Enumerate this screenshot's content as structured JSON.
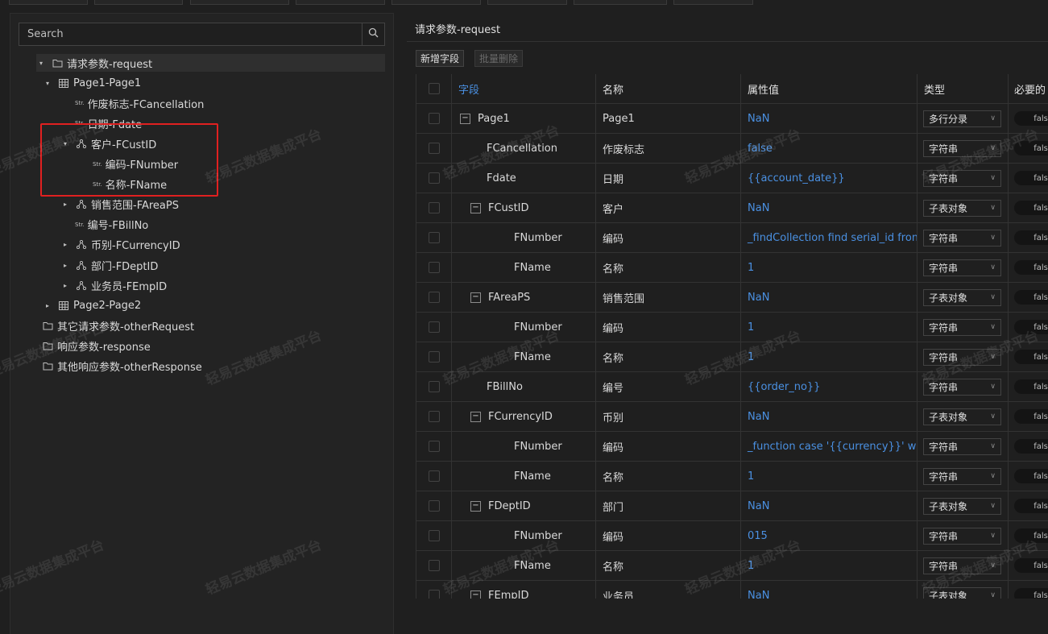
{
  "watermark": "轻易云数据集成平台",
  "search": {
    "placeholder": "Search"
  },
  "tree": [
    {
      "label": "请求参数-request",
      "icon": "folder-icon",
      "caret": "▾",
      "level": 0,
      "selected": true
    },
    {
      "label": "Page1-Page1",
      "icon": "table-icon",
      "caret": "▾",
      "level": 1
    },
    {
      "label": "作废标志-FCancellation",
      "icon": "string-icon",
      "caret": "",
      "level": 2
    },
    {
      "label": "日期-Fdate",
      "icon": "string-icon",
      "caret": "",
      "level": 2
    },
    {
      "label": "客户-FCustID",
      "icon": "object-icon",
      "caret": "▾",
      "level": 2
    },
    {
      "label": "编码-FNumber",
      "icon": "string-icon",
      "caret": "",
      "level": 3
    },
    {
      "label": "名称-FName",
      "icon": "string-icon",
      "caret": "",
      "level": 3
    },
    {
      "label": "销售范围-FAreaPS",
      "icon": "object-icon",
      "caret": "▸",
      "level": 2
    },
    {
      "label": "编号-FBillNo",
      "icon": "string-icon",
      "caret": "",
      "level": 2
    },
    {
      "label": "币别-FCurrencyID",
      "icon": "object-icon",
      "caret": "▸",
      "level": 2
    },
    {
      "label": "部门-FDeptID",
      "icon": "object-icon",
      "caret": "▸",
      "level": 2
    },
    {
      "label": "业务员-FEmpID",
      "icon": "object-icon",
      "caret": "▸",
      "level": 2
    },
    {
      "label": "Page2-Page2",
      "icon": "table-icon",
      "caret": "▸",
      "level": 1
    },
    {
      "label": "其它请求参数-otherRequest",
      "icon": "folder-icon",
      "caret": "",
      "level": 0
    },
    {
      "label": "响应参数-response",
      "icon": "folder-icon",
      "caret": "",
      "level": 0
    },
    {
      "label": "其他响应参数-otherResponse",
      "icon": "folder-icon",
      "caret": "",
      "level": 0
    }
  ],
  "tree_string_badge": "Str.",
  "panel": {
    "title": "请求参数-request",
    "add_button": "新增字段",
    "bulk_delete_button": "批量删除"
  },
  "table": {
    "headers": {
      "field": "字段",
      "name": "名称",
      "value": "属性值",
      "type": "类型",
      "required": "必要的"
    },
    "rows": [
      {
        "field": "Page1",
        "name": "Page1",
        "value": "NaN",
        "type": "多行分录",
        "required": "false",
        "indent": 0,
        "expand": true
      },
      {
        "field": "FCancellation",
        "name": "作废标志",
        "value": "false",
        "type": "字符串",
        "required": "false",
        "indent": 1,
        "expand": false
      },
      {
        "field": "Fdate",
        "name": "日期",
        "value": "{{account_date}}",
        "type": "字符串",
        "required": "false",
        "indent": 1,
        "expand": false
      },
      {
        "field": "FCustID",
        "name": "客户",
        "value": "NaN",
        "type": "子表对象",
        "required": "false",
        "indent": 1,
        "expand": true
      },
      {
        "field": "FNumber",
        "name": "编码",
        "value": "_findCollection find serial_id from ...",
        "type": "字符串",
        "required": "false",
        "indent": 2,
        "expand": false
      },
      {
        "field": "FName",
        "name": "名称",
        "value": "1",
        "type": "字符串",
        "required": "false",
        "indent": 2,
        "expand": false
      },
      {
        "field": "FAreaPS",
        "name": "销售范围",
        "value": "NaN",
        "type": "子表对象",
        "required": "false",
        "indent": 1,
        "expand": true
      },
      {
        "field": "FNumber",
        "name": "编码",
        "value": "1",
        "type": "字符串",
        "required": "false",
        "indent": 2,
        "expand": false
      },
      {
        "field": "FName",
        "name": "名称",
        "value": "1",
        "type": "字符串",
        "required": "false",
        "indent": 2,
        "expand": false
      },
      {
        "field": "FBillNo",
        "name": "编号",
        "value": "{{order_no}}",
        "type": "字符串",
        "required": "false",
        "indent": 1,
        "expand": false
      },
      {
        "field": "FCurrencyID",
        "name": "币别",
        "value": "NaN",
        "type": "子表对象",
        "required": "false",
        "indent": 1,
        "expand": true
      },
      {
        "field": "FNumber",
        "name": "编码",
        "value": "_function case '{{currency}}' when '...",
        "type": "字符串",
        "required": "false",
        "indent": 2,
        "expand": false
      },
      {
        "field": "FName",
        "name": "名称",
        "value": "1",
        "type": "字符串",
        "required": "false",
        "indent": 2,
        "expand": false
      },
      {
        "field": "FDeptID",
        "name": "部门",
        "value": "NaN",
        "type": "子表对象",
        "required": "false",
        "indent": 1,
        "expand": true
      },
      {
        "field": "FNumber",
        "name": "编码",
        "value": "015",
        "type": "字符串",
        "required": "false",
        "indent": 2,
        "expand": false
      },
      {
        "field": "FName",
        "name": "名称",
        "value": "1",
        "type": "字符串",
        "required": "false",
        "indent": 2,
        "expand": false
      },
      {
        "field": "FEmpID",
        "name": "业务员",
        "value": "NaN",
        "type": "子表对象",
        "required": "false",
        "indent": 1,
        "expand": true
      }
    ]
  },
  "colors": {
    "accent": "#4a90e2",
    "highlight_box": "#e02020",
    "background": "#1f1f1f"
  }
}
